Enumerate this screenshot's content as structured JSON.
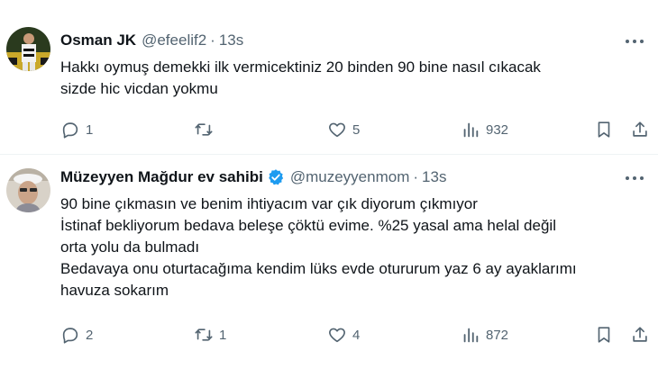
{
  "tweets": [
    {
      "author": {
        "name": "Osman JK",
        "handle": "@efeelif2",
        "verified": false
      },
      "separator": "·",
      "time": "13s",
      "text_lines": [
        "Hakkı oymuş demekki ilk vermicektiniz 20 binden 90 bine nasıl cıkacak",
        "sizde hic vicdan yokmu"
      ],
      "stats": {
        "replies": "1",
        "retweets": "",
        "likes": "5",
        "views": "932"
      }
    },
    {
      "author": {
        "name": "Müzeyyen Mağdur ev sahibi",
        "handle": "@muzeyyenmom",
        "verified": true
      },
      "separator": "·",
      "time": "13s",
      "text_lines": [
        "90 bine çıkmasın ve benim ihtiyacım var çık diyorum çıkmıyor",
        "İstinaf bekliyorum bedava beleşe çöktü evime. %25 yasal ama helal değil",
        "orta yolu da bulmadı",
        "Bedavaya onu oturtacağıma kendim lüks evde otururum yaz 6 ay ayaklarımı",
        "havuza sokarım"
      ],
      "stats": {
        "replies": "2",
        "retweets": "1",
        "likes": "4",
        "views": "872"
      }
    }
  ],
  "colors": {
    "text": "#0f1419",
    "secondary": "#536471",
    "verified": "#1d9bf0",
    "divider": "#eff3f4"
  },
  "icons": [
    "reply-icon",
    "retweet-icon",
    "like-icon",
    "views-icon",
    "bookmark-icon",
    "share-icon",
    "more-icon",
    "verified-badge-icon"
  ]
}
